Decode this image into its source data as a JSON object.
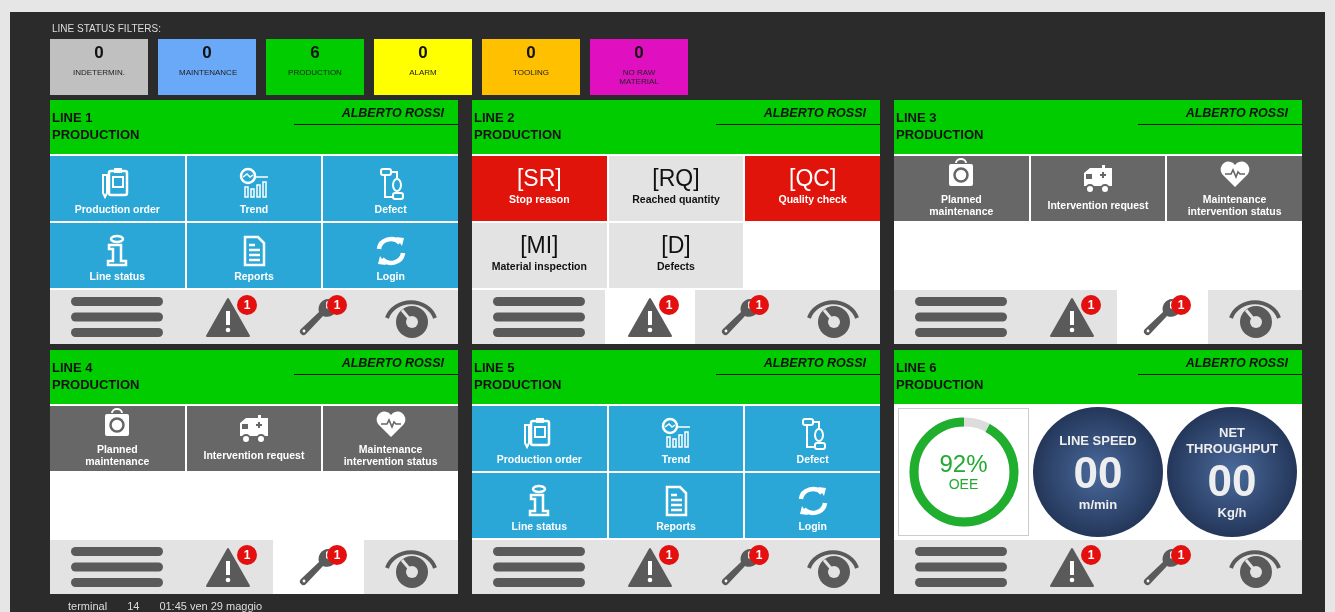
{
  "filters_title": "LINE STATUS FILTERS:",
  "filters": [
    {
      "count": "0",
      "label": "INDETERMIN.",
      "color": "#c0c0c0"
    },
    {
      "count": "0",
      "label": "MAINTENANCE",
      "color": "#6aa8f8"
    },
    {
      "count": "6",
      "label": "PRODUCTION",
      "color": "#00cc00"
    },
    {
      "count": "0",
      "label": "ALARM",
      "color": "#ffff00"
    },
    {
      "count": "0",
      "label": "TOOLING",
      "color": "#ffc000"
    },
    {
      "count": "0",
      "label": "NO RAW MATERIAL",
      "color": "#e010c0"
    }
  ],
  "lines": [
    {
      "name": "LINE 1",
      "status": "PRODUCTION",
      "operator": "ALBERTO ROSSI",
      "panel": {
        "kind": "menu",
        "tiles": [
          {
            "label": "Production order"
          },
          {
            "label": "Trend"
          },
          {
            "label": "Defect"
          },
          {
            "label": "Line status"
          },
          {
            "label": "Reports"
          },
          {
            "label": "Login"
          }
        ]
      },
      "toolbar": [
        {
          "kind": "menu",
          "selected": false
        },
        {
          "kind": "alerts",
          "badge": "1",
          "selected": false
        },
        {
          "kind": "maintenance",
          "badge": "1",
          "selected": false
        },
        {
          "kind": "gauge",
          "selected": false
        }
      ]
    },
    {
      "name": "LINE 2",
      "status": "PRODUCTION",
      "operator": "ALBERTO ROSSI",
      "panel": {
        "kind": "codes",
        "tiles": [
          {
            "code": "[SR]",
            "label": "Stop reason",
            "alert": true
          },
          {
            "code": "[RQ]",
            "label": "Reached quantity",
            "alert": false
          },
          {
            "code": "[QC]",
            "label": "Quality check",
            "alert": true
          },
          {
            "code": "[MI]",
            "label": "Material inspection",
            "alert": false
          },
          {
            "code": "[D]",
            "label": "Defects",
            "alert": false
          }
        ]
      },
      "toolbar": [
        {
          "kind": "menu",
          "selected": false
        },
        {
          "kind": "alerts",
          "badge": "1",
          "selected": true
        },
        {
          "kind": "maintenance",
          "badge": "1",
          "selected": false
        },
        {
          "kind": "gauge",
          "selected": false
        }
      ]
    },
    {
      "name": "LINE 3",
      "status": "PRODUCTION",
      "operator": "ALBERTO ROSSI",
      "panel": {
        "kind": "maintenance",
        "tiles": [
          {
            "label": "Planned maintenance"
          },
          {
            "label": "Intervention request"
          },
          {
            "label": "Maintenance intervention status"
          }
        ]
      },
      "toolbar": [
        {
          "kind": "menu",
          "selected": false
        },
        {
          "kind": "alerts",
          "badge": "1",
          "selected": false
        },
        {
          "kind": "maintenance",
          "badge": "1",
          "selected": true
        },
        {
          "kind": "gauge",
          "selected": false
        }
      ]
    },
    {
      "name": "LINE 4",
      "status": "PRODUCTION",
      "operator": "ALBERTO ROSSI",
      "panel": {
        "kind": "maintenance",
        "tiles": [
          {
            "label": "Planned maintenance"
          },
          {
            "label": "Intervention request"
          },
          {
            "label": "Maintenance intervention status"
          }
        ]
      },
      "toolbar": [
        {
          "kind": "menu",
          "selected": false
        },
        {
          "kind": "alerts",
          "badge": "1",
          "selected": false
        },
        {
          "kind": "maintenance",
          "badge": "1",
          "selected": true
        },
        {
          "kind": "gauge",
          "selected": false
        }
      ]
    },
    {
      "name": "LINE 5",
      "status": "PRODUCTION",
      "operator": "ALBERTO ROSSI",
      "panel": {
        "kind": "menu",
        "tiles": [
          {
            "label": "Production order"
          },
          {
            "label": "Trend"
          },
          {
            "label": "Defect"
          },
          {
            "label": "Line status"
          },
          {
            "label": "Reports"
          },
          {
            "label": "Login"
          }
        ]
      },
      "toolbar": [
        {
          "kind": "menu",
          "selected": false
        },
        {
          "kind": "alerts",
          "badge": "1",
          "selected": false
        },
        {
          "kind": "maintenance",
          "badge": "1",
          "selected": false
        },
        {
          "kind": "gauge",
          "selected": false
        }
      ]
    },
    {
      "name": "LINE 6",
      "status": "PRODUCTION",
      "operator": "ALBERTO ROSSI",
      "panel": {
        "kind": "kpi",
        "oee": {
          "value": "92%",
          "label": "OEE",
          "level": 0.92
        },
        "gauges": [
          {
            "title": "LINE SPEED",
            "value": "00",
            "unit": "m/min"
          },
          {
            "title": "NET THROUGHPUT",
            "value": "00",
            "unit": "Kg/h"
          }
        ]
      },
      "toolbar": [
        {
          "kind": "menu",
          "selected": false
        },
        {
          "kind": "alerts",
          "badge": "1",
          "selected": false
        },
        {
          "kind": "maintenance",
          "badge": "1",
          "selected": false
        },
        {
          "kind": "gauge",
          "selected": false
        }
      ]
    }
  ],
  "status_bar": {
    "terminal": "terminal",
    "number": "14",
    "datetime": "01:45 ven 29 maggio"
  }
}
